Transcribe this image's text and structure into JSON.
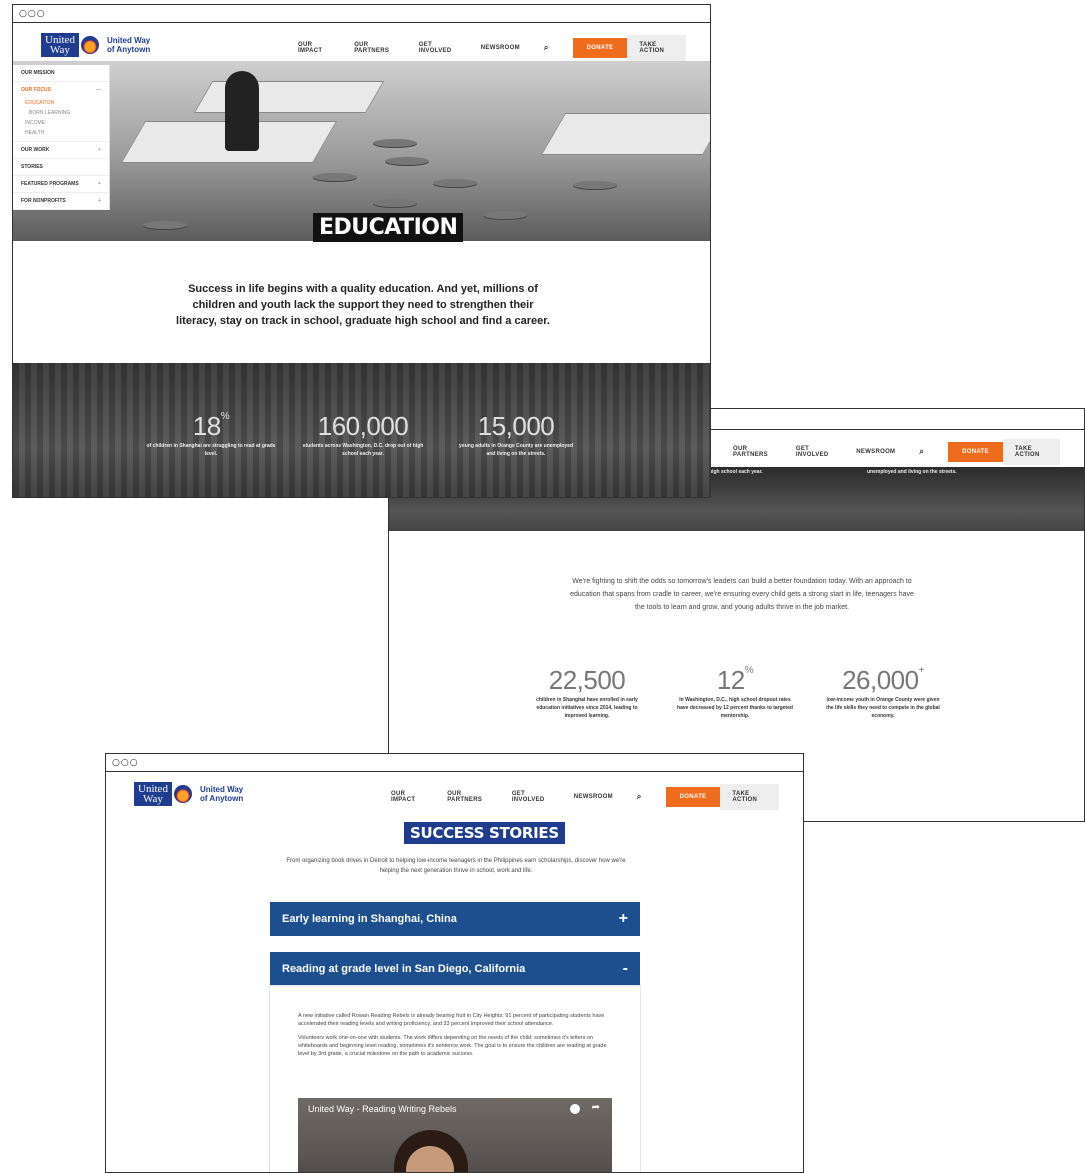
{
  "brand": {
    "logo_line1": "United",
    "logo_line2": "Way",
    "name_line1": "United Way",
    "name_line2": "of Anytown"
  },
  "nav": {
    "impact": "OUR IMPACT",
    "partners": "OUR PARTNERS",
    "involved": "GET INVOLVED",
    "newsroom": "NEWSROOM",
    "donate": "DONATE",
    "take_action": "TAKE ACTION"
  },
  "sidebar": {
    "items": [
      {
        "label": "OUR MISSION",
        "sign": ""
      },
      {
        "label": "OUR FOCUS",
        "sign": "—"
      },
      {
        "label": "OUR WORK",
        "sign": "+"
      },
      {
        "label": "STORIES",
        "sign": ""
      },
      {
        "label": "FEATURED PROGRAMS",
        "sign": "+"
      },
      {
        "label": "FOR NONPROFITS",
        "sign": "+"
      }
    ],
    "subitems": [
      "EDUCATION",
      "BORN LEARNING",
      "INCOME",
      "HEALTH"
    ]
  },
  "education": {
    "title": "EDUCATION",
    "intro": "Success in life begins with a quality education. And yet, millions of children and youth lack the support they need to strengthen their literacy, stay on track in school, graduate high school and find a career.",
    "stats": [
      {
        "number": "18",
        "suffix": "%",
        "desc": "of children in Shanghai are struggling to read at grade level."
      },
      {
        "number": "160,000",
        "suffix": "",
        "desc": "students across Washington, D.C. drop out of high school each year."
      },
      {
        "number": "15,000",
        "suffix": "",
        "desc": "young adults in Orange County are unemployed and living on the streets."
      }
    ]
  },
  "window2": {
    "top_left_text": "high school each year.",
    "top_right_text": "unemployed and living on the streets.",
    "intro": "We're fighting to shift the odds so tomorrow's leaders can build a better foundation today. With an approach to education that spans from cradle to career, we're ensuring every child gets a strong start in life, teenagers have the tools to learn and grow, and young adults thrive in the job market.",
    "stats": [
      {
        "number": "22,500",
        "suffix": "",
        "desc": "children in Shanghai have enrolled in early education initiatives since 2014, leading to improved learning."
      },
      {
        "number": "12",
        "suffix": "%",
        "desc": "In Washington, D.C., high school dropout rates have decreased by 12 percent thanks to targeted mentorship."
      },
      {
        "number": "26,000",
        "suffix": "+",
        "desc": "low-income youth in Orange County were given the life skills they need to compete in the global economy."
      }
    ]
  },
  "stories": {
    "title": "SUCCESS STORIES",
    "intro": "From organizing book drives in Detroit to helping low-income teenagers in the Philippines earn scholarships, discover how we're helping the next generation thrive in school, work and life.",
    "accordion": [
      {
        "title": "Early learning in Shanghai, China",
        "sign": "+"
      },
      {
        "title": "Reading at grade level in San Diego, California",
        "sign": "-"
      }
    ],
    "panel_p1": "A new initiative called Rowan Reading Rebels is already bearing fruit in City Heights: 91 percent of participating students have accelerated their reading levels and writing proficiency, and 33 percent improved their school attendance.",
    "panel_p2": "Volunteers work one-on-one with students. The work differs depending on the needs of the child: sometimes it's letters on whiteboards and beginning level reading, sometimes it's sentence work. The goal is to ensure the children are reading at grade level by 3rd grade, a crucial milestone on the path to academic success.",
    "video_title": "United Way - Reading Writing Rebels"
  },
  "window_dots": "○○○"
}
